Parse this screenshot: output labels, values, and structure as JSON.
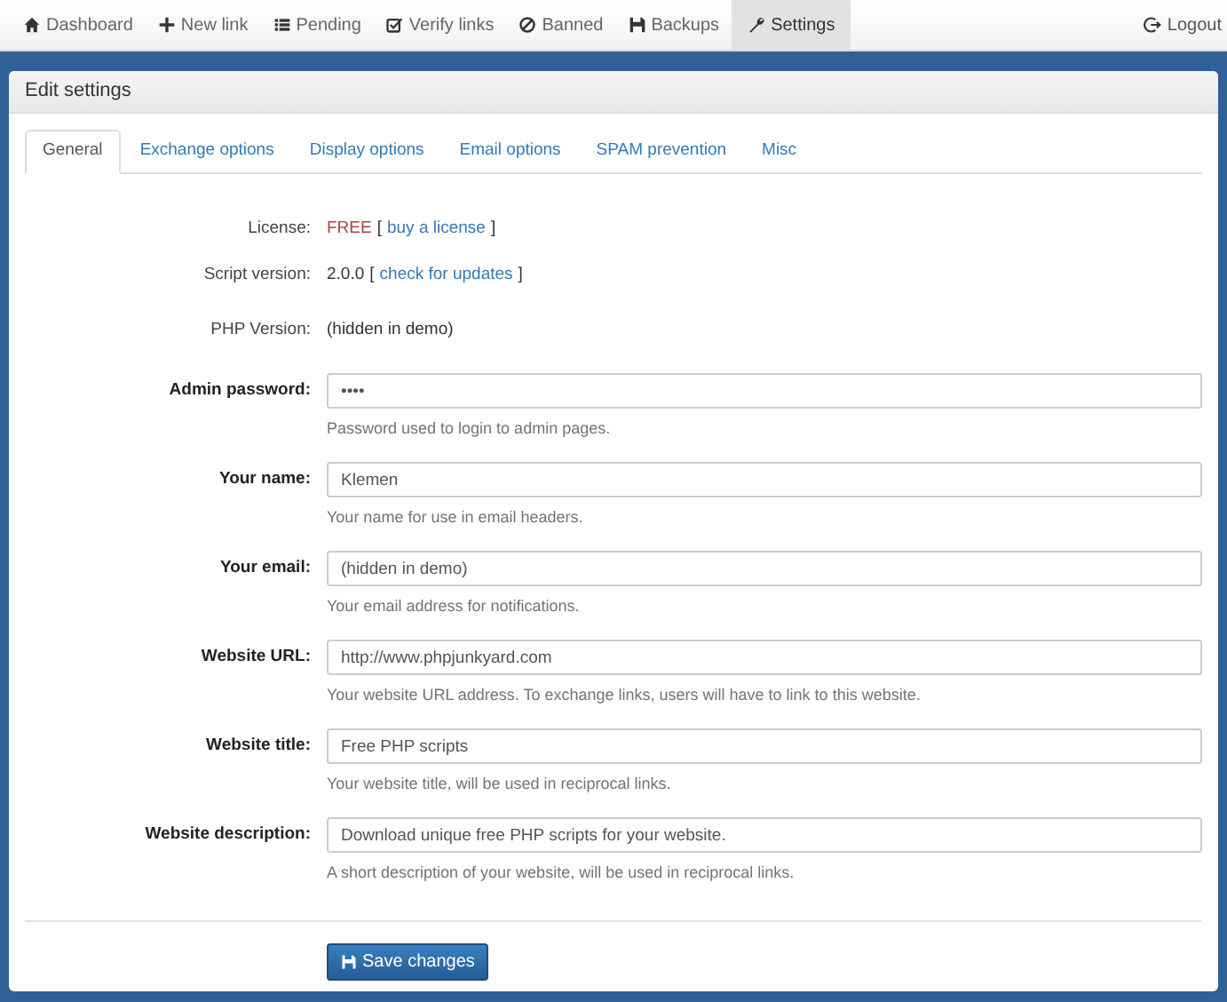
{
  "nav": {
    "items": [
      {
        "label": "Dashboard",
        "selected": false
      },
      {
        "label": "New link",
        "selected": false
      },
      {
        "label": "Pending",
        "selected": false
      },
      {
        "label": "Verify links",
        "selected": false
      },
      {
        "label": "Banned",
        "selected": false
      },
      {
        "label": "Backups",
        "selected": false
      },
      {
        "label": "Settings",
        "selected": true
      }
    ],
    "logout": "Logout"
  },
  "panel": {
    "title": "Edit settings",
    "tabs": [
      {
        "label": "General",
        "selected": true
      },
      {
        "label": "Exchange options",
        "selected": false
      },
      {
        "label": "Display options",
        "selected": false
      },
      {
        "label": "Email options",
        "selected": false
      },
      {
        "label": "SPAM prevention",
        "selected": false
      },
      {
        "label": "Misc",
        "selected": false
      }
    ],
    "info_rows": [
      {
        "label": "License:",
        "kind": "license",
        "value": "FREE",
        "link_open": "[",
        "link": "buy a license",
        "link_close": "]"
      },
      {
        "label": "Script version:",
        "kind": "plain",
        "value": "2.0.0",
        "link_open": "[",
        "link": "check for updates",
        "link_close": "]"
      },
      {
        "label": "PHP Version:",
        "kind": "plain",
        "value": "(hidden in demo)"
      }
    ],
    "fields": [
      {
        "label": "Admin password:",
        "value": "••••",
        "help": "Password used to login to admin pages."
      },
      {
        "label": "Your name:",
        "value": "Klemen",
        "help": "Your name for use in email headers."
      },
      {
        "label": "Your email:",
        "value": "(hidden in demo)",
        "help": "Your email address for notifications."
      },
      {
        "label": "Website URL:",
        "value": "http://www.phpjunkyard.com",
        "help": "Your website URL address. To exchange links, users will have to link to this website."
      },
      {
        "label": "Website title:",
        "value": "Free PHP scripts",
        "help": "Your website title, will be used in reciprocal links."
      },
      {
        "label": "Website description:",
        "value": "Download unique free PHP scripts for your website.",
        "help": "A short description of your website, will be used in reciprocal links."
      }
    ],
    "save_button": "Save changes"
  }
}
